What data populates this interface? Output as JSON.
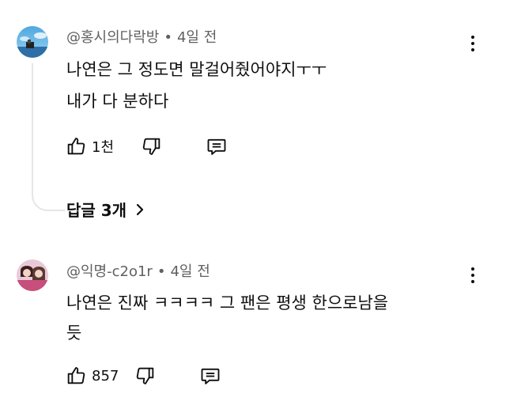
{
  "comments": [
    {
      "author": "@홍시의다락방",
      "separator": "•",
      "time": "4일 전",
      "text_lines": [
        "나연은 그 정도면 말걸어줬어야지ㅜㅜ",
        "내가 다 분하다"
      ],
      "like_count": "1천",
      "replies_label": "답글 3개",
      "avatar_icon": "avatar-sky-boat-image"
    },
    {
      "author": "@익명-c2o1r",
      "separator": "•",
      "time": "4일 전",
      "text_lines": [
        "나연은 진짜 ㅋㅋㅋㅋ 그 팬은 평생 한으로남을",
        "듯"
      ],
      "like_count": "857",
      "avatar_icon": "avatar-two-people-image"
    }
  ],
  "icons": {
    "like": "thumbs-up-icon",
    "dislike": "thumbs-down-icon",
    "reply": "reply-comment-icon",
    "more": "more-vertical-icon",
    "chevron": "chevron-right-icon"
  },
  "colors": {
    "text": "#0f0f0f",
    "meta": "#606060",
    "thread_line": "#e5e5e5"
  }
}
